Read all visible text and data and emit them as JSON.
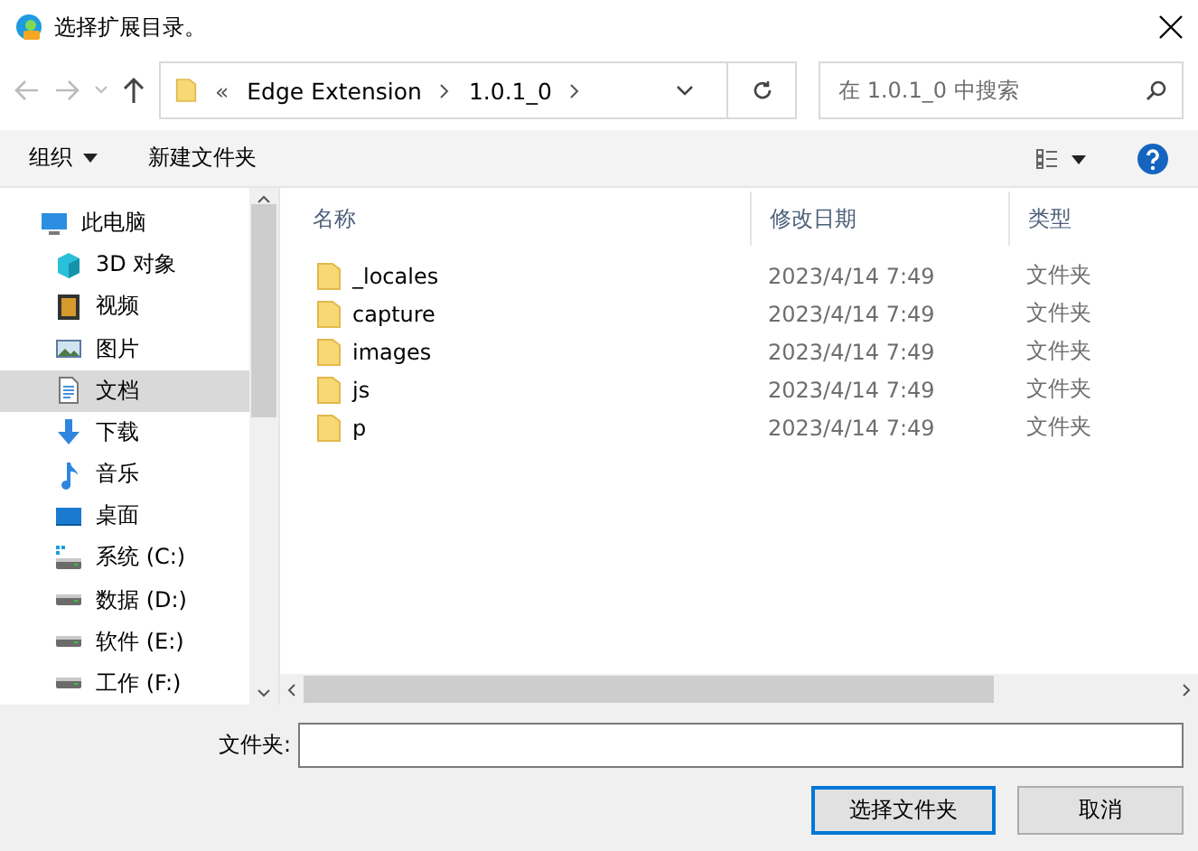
{
  "window": {
    "title": "选择扩展目录。"
  },
  "address": {
    "overflow": "«",
    "crumbs": [
      "Edge Extension",
      "1.0.1_0"
    ]
  },
  "search": {
    "placeholder": "在 1.0.1_0 中搜索"
  },
  "toolbar": {
    "organize": "组织",
    "new_folder": "新建文件夹"
  },
  "sidebar": {
    "items": [
      {
        "label": "此电脑",
        "kind": "pc",
        "selected": false
      },
      {
        "label": "3D 对象",
        "kind": "cube",
        "selected": false
      },
      {
        "label": "视频",
        "kind": "video",
        "selected": false
      },
      {
        "label": "图片",
        "kind": "pictures",
        "selected": false
      },
      {
        "label": "文档",
        "kind": "document",
        "selected": true
      },
      {
        "label": "下载",
        "kind": "download",
        "selected": false
      },
      {
        "label": "音乐",
        "kind": "music",
        "selected": false
      },
      {
        "label": "桌面",
        "kind": "desktop",
        "selected": false
      },
      {
        "label": "系统 (C:)",
        "kind": "system-drive",
        "selected": false
      },
      {
        "label": "数据 (D:)",
        "kind": "drive",
        "selected": false
      },
      {
        "label": "软件 (E:)",
        "kind": "drive",
        "selected": false
      },
      {
        "label": "工作 (F:)",
        "kind": "drive",
        "selected": false
      }
    ]
  },
  "table": {
    "columns": [
      "名称",
      "修改日期",
      "类型"
    ],
    "rows": [
      {
        "name": "_locales",
        "modified": "2023/4/14 7:49",
        "type": "文件夹"
      },
      {
        "name": "capture",
        "modified": "2023/4/14 7:49",
        "type": "文件夹"
      },
      {
        "name": "images",
        "modified": "2023/4/14 7:49",
        "type": "文件夹"
      },
      {
        "name": "js",
        "modified": "2023/4/14 7:49",
        "type": "文件夹"
      },
      {
        "name": "p",
        "modified": "2023/4/14 7:49",
        "type": "文件夹"
      }
    ]
  },
  "footer": {
    "folder_label": "文件夹:",
    "buttons": [
      "选择文件夹",
      "取消"
    ]
  }
}
